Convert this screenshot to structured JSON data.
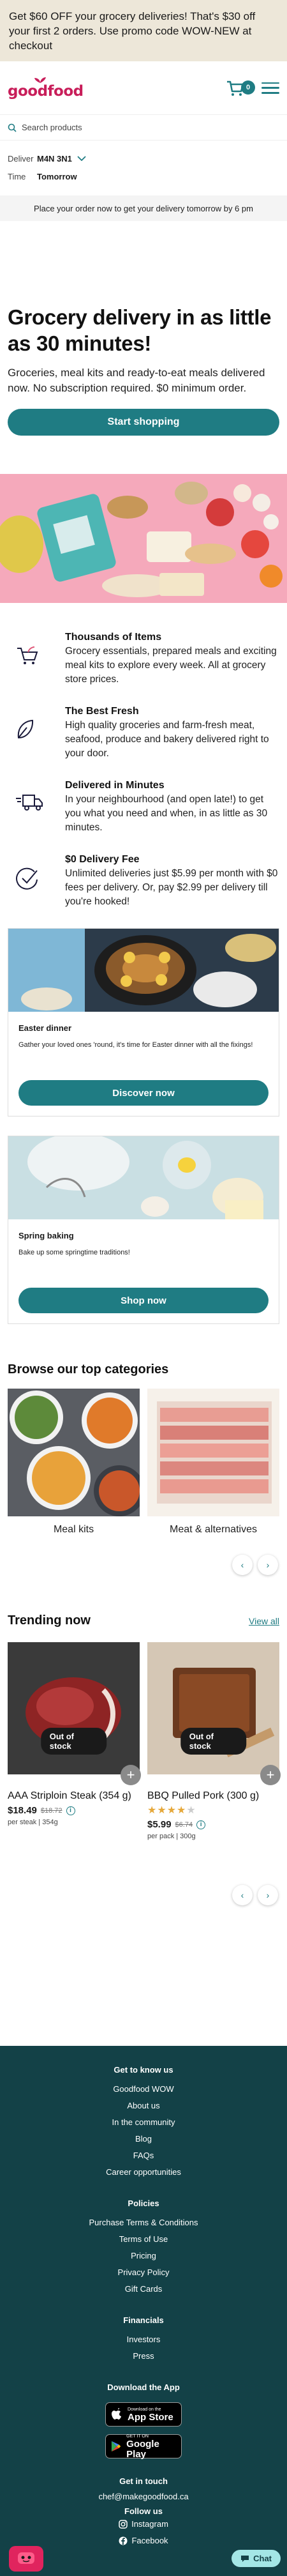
{
  "promo_bar": {
    "text": "Get $60 OFF your grocery deliveries! That's $30 off your first 2 orders. Use promo code WOW-NEW at checkout"
  },
  "header": {
    "logo": "goodfood",
    "cart_count": "0"
  },
  "search": {
    "placeholder": "Search products"
  },
  "delivery": {
    "deliver_label": "Deliver",
    "deliver_value": "M4N 3N1",
    "time_label": "Time",
    "time_value": "Tomorrow",
    "banner": "Place your order now to get your delivery tomorrow by 6 pm"
  },
  "hero": {
    "title": "Grocery delivery in as little as 30 minutes!",
    "subtitle": "Groceries, meal kits and ready-to-eat meals delivered now. No subscription required. $0 minimum order.",
    "cta": "Start shopping"
  },
  "features": [
    {
      "icon": "basket-icon",
      "title": "Thousands of Items",
      "text": "Grocery essentials, prepared meals and exciting meal kits to explore every week. All at grocery store prices."
    },
    {
      "icon": "leaf-icon",
      "title": "The Best Fresh",
      "text": "High quality groceries and farm-fresh meat, seafood, produce and bakery delivered right to your door."
    },
    {
      "icon": "truck-icon",
      "title": "Delivered in Minutes",
      "text": "In your neighbourhood (and open late!) to get you what you need and when, in as little as 30 minutes."
    },
    {
      "icon": "checkmark-circle-icon",
      "title": "$0 Delivery Fee",
      "text": "Unlimited deliveries just $5.99 per month with $0 fees per delivery. Or, pay $2.99 per delivery till you're hooked!"
    }
  ],
  "cards": [
    {
      "title": "Easter dinner",
      "desc": "Gather your loved ones 'round, it's time for Easter dinner with all the fixings!",
      "button": "Discover now"
    },
    {
      "title": "Spring baking",
      "desc": "Bake up some springtime traditions!",
      "button": "Shop now"
    }
  ],
  "categories": {
    "title": "Browse our top categories",
    "items": [
      {
        "label": "Meal kits"
      },
      {
        "label": "Meat & alternatives"
      }
    ]
  },
  "trending": {
    "title": "Trending now",
    "view_all": "View all",
    "products": [
      {
        "name": "AAA Striploin Steak (354 g)",
        "badge": "Out of stock",
        "price": "$18.49",
        "old_price": "$18.72",
        "unit": "per steak | 354g",
        "rating": 0
      },
      {
        "name": "BBQ Pulled Pork (300 g)",
        "badge": "Out of stock",
        "price": "$5.99",
        "old_price": "$6.74",
        "unit": "per pack | 300g",
        "rating": 4
      }
    ]
  },
  "footer": {
    "sections": [
      {
        "title": "Get to know us",
        "links": [
          "Goodfood WOW",
          "About us",
          "In the community",
          "Blog",
          "FAQs",
          "Career opportunities"
        ]
      },
      {
        "title": "Policies",
        "links": [
          "Purchase Terms & Conditions",
          "Terms of Use",
          "Pricing",
          "Privacy Policy",
          "Gift Cards"
        ]
      },
      {
        "title": "Financials",
        "links": [
          "Investors",
          "Press"
        ]
      }
    ],
    "download_title": "Download the App",
    "appstore_small": "Download on the",
    "appstore_big": "App Store",
    "googleplay_small": "GET IT ON",
    "googleplay_big": "Google Play",
    "get_in_touch": "Get in touch",
    "email": "chef@makegoodfood.ca",
    "follow_us": "Follow us",
    "instagram": "Instagram",
    "facebook": "Facebook",
    "chat": "Chat"
  },
  "colors": {
    "brand": "#c81e5a",
    "teal": "#1f7c83",
    "footer_bg": "#134147",
    "promo_bg": "#ede7d9"
  }
}
